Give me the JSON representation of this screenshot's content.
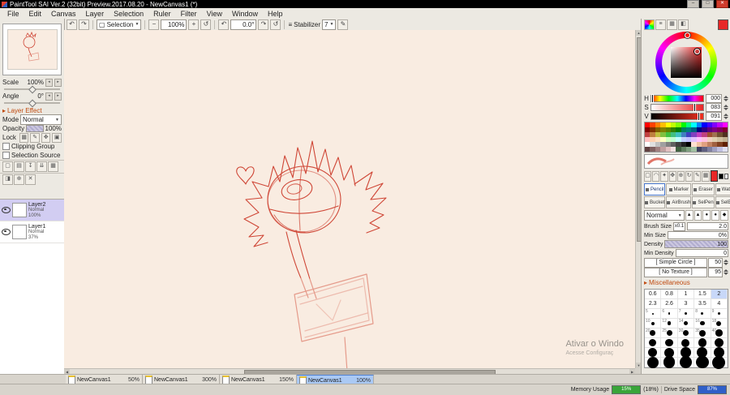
{
  "window": {
    "title": "PaintTool SAI Ver.2 (32bit) Preview.2017.08.20 - NewCanvas1 (*)",
    "controls": {
      "minimize": "–",
      "maximize": "□",
      "close": "✕"
    }
  },
  "menubar": {
    "items": [
      "File",
      "Edit",
      "Canvas",
      "Layer",
      "Selection",
      "Ruler",
      "Filter",
      "View",
      "Window",
      "Help"
    ]
  },
  "toolbar": {
    "selection_label": "Selection",
    "zoom_value": "100%",
    "angle_value": "0.0°",
    "stabilizer_label": "Stabilizer",
    "stabilizer_value": "7"
  },
  "icons": {
    "undo": "↶",
    "redo": "↷",
    "selection": "▢",
    "arrow_down": "▼",
    "minus": "−",
    "plus": "+",
    "reset": "↺",
    "stabilizer": "≡",
    "pen": "✎",
    "section_arrow": "▸",
    "lock": [
      "▦",
      "✎",
      "✥",
      "▣"
    ],
    "layer_row1": [
      "▢",
      "▤",
      "↧",
      "⇊",
      "▦"
    ],
    "layer_row2": [
      "◨",
      "⊕",
      "✕"
    ],
    "util": [
      "▢",
      "◠",
      "✦",
      "✥",
      "⊕",
      "↻",
      "✎",
      "▦"
    ],
    "tips": [
      "▲",
      "▲",
      "●",
      "●",
      "◆"
    ],
    "panel_tabs": [
      "◍",
      "≡",
      "▦",
      "◧"
    ],
    "scroll_up": "▲",
    "scroll_down": "▼",
    "scroll_left": "◀",
    "scroll_right": "▶"
  },
  "left_panel": {
    "scale_label": "Scale",
    "scale_value": "100%",
    "angle_label": "Angle",
    "angle_value": "0°",
    "layer_effect_header": "Layer Effect",
    "mode_label": "Mode",
    "mode_value": "Normal",
    "opacity_label": "Opacity",
    "opacity_value": "100%",
    "lock_label": "Lock",
    "clipping_group_label": "Clipping Group",
    "selection_source_label": "Selection Source",
    "layers": [
      {
        "name": "Layer2",
        "mode": "Normal",
        "opacity": "100%"
      },
      {
        "name": "Layer1",
        "mode": "Normal",
        "opacity": "37%"
      }
    ]
  },
  "canvas": {
    "background": "#f9ece1",
    "sketch_color": "#cf4636",
    "sketch_color_light": "#e59a8a",
    "watermark_line1": "Ativar o Windo",
    "watermark_line2": "Acesse Configuraç"
  },
  "color_panel": {
    "h_label": "H",
    "h_value": "000",
    "s_label": "S",
    "s_value": "083",
    "v_label": "V",
    "v_value": "091",
    "current_color": "#e82727"
  },
  "palette": {
    "rows": [
      [
        "#ff0000",
        "#ff4000",
        "#ff8000",
        "#ffbf00",
        "#ffff00",
        "#bfff00",
        "#80ff00",
        "#00ff00",
        "#00ff80",
        "#00ffff",
        "#0080ff",
        "#0000ff",
        "#4000ff",
        "#8000ff",
        "#bf00ff",
        "#ff00ff"
      ],
      [
        "#800000",
        "#803000",
        "#806000",
        "#808000",
        "#608000",
        "#308000",
        "#008000",
        "#008060",
        "#008080",
        "#006080",
        "#000080",
        "#300080",
        "#600080",
        "#800080",
        "#800060",
        "#800030"
      ],
      [
        "#c04040",
        "#c08040",
        "#c0c040",
        "#80c040",
        "#40c040",
        "#40c080",
        "#40c0c0",
        "#4080c0",
        "#4040c0",
        "#8040c0",
        "#c040c0",
        "#c04080",
        "#a05030",
        "#a07050",
        "#705030",
        "#503020"
      ],
      [
        "#ffc0c0",
        "#ffd0b0",
        "#ffe0c0",
        "#ffffc0",
        "#d0ffc0",
        "#c0ffd0",
        "#c0ffff",
        "#c0d0ff",
        "#c0c0ff",
        "#e0c0ff",
        "#ffc0ff",
        "#ffc0e0",
        "#f0d0c0",
        "#e0d0b0",
        "#d0c0a0",
        "#c0b090"
      ],
      [
        "#ffffff",
        "#e0e0e0",
        "#c0c0c0",
        "#a0a0a0",
        "#808080",
        "#606060",
        "#404040",
        "#202020",
        "#000000",
        "#ffe0d0",
        "#f0c0a0",
        "#e0a080",
        "#c08060",
        "#a06040",
        "#804020",
        "#602000"
      ],
      [
        "#604040",
        "#806060",
        "#a08080",
        "#c0a0a0",
        "#e0c0c0",
        "#f0e0e0",
        "#406040",
        "#608060",
        "#80a080",
        "#a0c0a0",
        "#404060",
        "#606080",
        "#8080a0",
        "#a0a0c0",
        "#c0c0e0",
        "#e0e0f0"
      ]
    ]
  },
  "tools": {
    "items": [
      {
        "label": "Pencil",
        "selected": true
      },
      {
        "label": "Marker"
      },
      {
        "label": "Eraser"
      },
      {
        "label": "Water"
      },
      {
        "label": "Bucket"
      },
      {
        "label": "AirBrush"
      },
      {
        "label": "SelPen"
      },
      {
        "label": "SelErs"
      }
    ]
  },
  "brush": {
    "blend_mode": "Normal",
    "size_label": "Brush Size",
    "size_unit": "x0.1",
    "size_value": "2.0",
    "min_size_label": "Min Size",
    "min_size_value": "0%",
    "density_label": "Density",
    "density_value": "100",
    "min_density_label": "Min Density",
    "min_density_value": "0",
    "shape_label": "[ Simple Circle ]",
    "shape_value": "50",
    "texture_label": "[ No Texture ]",
    "texture_value": "95",
    "misc_header": "Miscellaneous"
  },
  "size_grid": {
    "selected": [
      0,
      4
    ],
    "rows": [
      [
        {
          "label": "0.6",
          "dot": 0
        },
        {
          "label": "0.8",
          "dot": 0
        },
        {
          "label": "1",
          "dot": 0
        },
        {
          "label": "1.5",
          "dot": 0
        },
        {
          "label": "2",
          "dot": 0
        }
      ],
      [
        {
          "label": "2.3",
          "dot": 0
        },
        {
          "label": "2.6",
          "dot": 0
        },
        {
          "label": "3",
          "dot": 0
        },
        {
          "label": "3.5",
          "dot": 0
        },
        {
          "label": "4",
          "dot": 0
        }
      ],
      [
        {
          "label": "5",
          "dot": 2
        },
        {
          "label": "6",
          "dot": 2.5
        },
        {
          "label": "7",
          "dot": 3
        },
        {
          "label": "8",
          "dot": 3
        },
        {
          "label": "9",
          "dot": 3.5
        }
      ],
      [
        {
          "label": "10",
          "dot": 4
        },
        {
          "label": "12",
          "dot": 4.5
        },
        {
          "label": "14",
          "dot": 5
        },
        {
          "label": "16",
          "dot": 5.5
        },
        {
          "label": "18",
          "dot": 6
        }
      ],
      [
        {
          "label": "20",
          "dot": 6.5
        },
        {
          "label": "25",
          "dot": 7
        },
        {
          "label": "30",
          "dot": 7.5
        },
        {
          "label": "35",
          "dot": 8
        },
        {
          "label": "40",
          "dot": 8.5
        }
      ],
      [
        {
          "label": "50",
          "dot": 9
        },
        {
          "label": "60",
          "dot": 9.5
        },
        {
          "label": "70",
          "dot": 10
        },
        {
          "label": "80",
          "dot": 10.5
        },
        {
          "label": "90",
          "dot": 11
        }
      ],
      [
        {
          "label": "100",
          "dot": 11.5
        },
        {
          "label": "125",
          "dot": 12
        },
        {
          "label": "150",
          "dot": 12.5
        },
        {
          "label": "175",
          "dot": 13
        },
        {
          "label": "200",
          "dot": 13.5
        }
      ],
      [
        {
          "label": "250",
          "dot": 14
        },
        {
          "label": "300",
          "dot": 14.5
        },
        {
          "label": "350",
          "dot": 15
        },
        {
          "label": "400",
          "dot": 15.5
        },
        {
          "label": "500",
          "dot": 16
        }
      ]
    ]
  },
  "tabs": [
    {
      "name": "NewCanvas1",
      "zoom": "50%"
    },
    {
      "name": "NewCanvas1",
      "zoom": "300%"
    },
    {
      "name": "NewCanvas1",
      "zoom": "150%"
    },
    {
      "name": "NewCanvas1",
      "zoom": "100%",
      "selected": true
    }
  ],
  "statusbar": {
    "memory_label": "Memory Usage",
    "memory_percent": "15%",
    "memory_extra": "(18%)",
    "drive_label": "Drive Space",
    "drive_percent": "87%"
  }
}
